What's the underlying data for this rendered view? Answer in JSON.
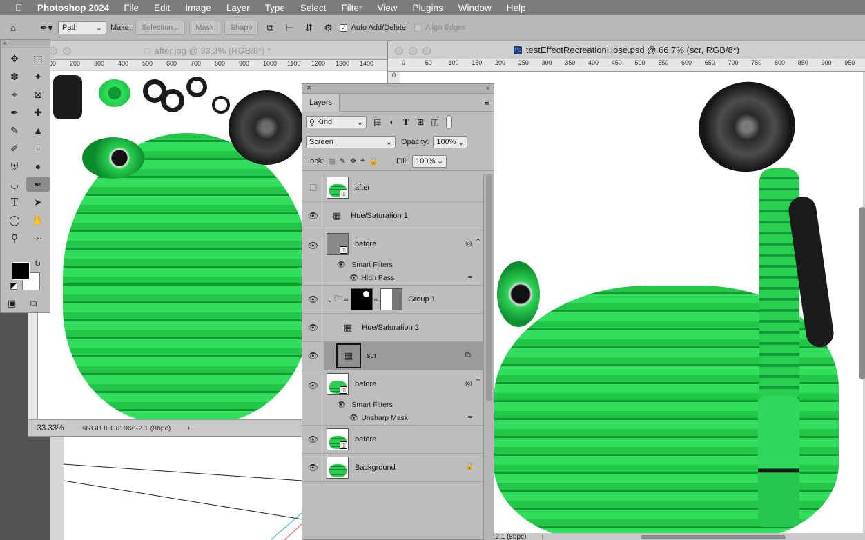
{
  "menubar": {
    "app_name": "Photoshop 2024",
    "items": [
      "File",
      "Edit",
      "Image",
      "Layer",
      "Type",
      "Select",
      "Filter",
      "View",
      "Plugins",
      "Window",
      "Help"
    ]
  },
  "options_bar": {
    "mode_select": "Path",
    "make_label": "Make:",
    "selection_button": "Selection...",
    "mask_button": "Mask",
    "shape_button": "Shape",
    "auto_add_delete_label": "Auto Add/Delete",
    "auto_add_delete_checked": true,
    "align_edges_label": "Align Edges"
  },
  "doc1": {
    "title": "after.jpg @ 33,3% (RGB/8*) *",
    "ruler_ticks": [
      "100",
      "200",
      "300",
      "400",
      "500",
      "600",
      "700",
      "800",
      "900",
      "1000",
      "1100",
      "1200",
      "1300",
      "1400"
    ],
    "zoom": "33.33%",
    "profile": "sRGB IEC61966-2.1 (8bpc)",
    "profile_arrow": "›"
  },
  "doc2": {
    "title": "testEffectRecreationHose.psd @ 66,7% (scr, RGB/8*)",
    "ruler_ticks": [
      "0",
      "50",
      "100",
      "150",
      "200",
      "250",
      "300",
      "350",
      "400",
      "450",
      "500",
      "550",
      "600",
      "650",
      "700",
      "750",
      "800",
      "850",
      "900",
      "950"
    ],
    "v_ruler": "0",
    "status": "-2.1 (8bpc)",
    "status_arrow": "›"
  },
  "layers_panel": {
    "tab": "Layers",
    "filter_kind": "Kind",
    "blend_mode": "Screen",
    "opacity_label": "Opacity:",
    "opacity_value": "100%",
    "lock_label": "Lock:",
    "fill_label": "Fill:",
    "fill_value": "100%",
    "layers": [
      {
        "name": "after",
        "visible": false
      },
      {
        "name": "Hue/Saturation 1",
        "visible": true
      },
      {
        "name": "before",
        "visible": true,
        "smart_filters_label": "Smart Filters",
        "filter": "High Pass"
      },
      {
        "name": "Group 1",
        "visible": true
      },
      {
        "name": "Hue/Saturation 2",
        "visible": true
      },
      {
        "name": "scr",
        "visible": true,
        "selected": true
      },
      {
        "name": "before",
        "visible": true,
        "smart_filters_label": "Smart Filters",
        "filter": "Unsharp Mask"
      },
      {
        "name": "before",
        "visible": true
      },
      {
        "name": "Background",
        "visible": true,
        "locked": true
      }
    ]
  },
  "colors": {
    "menubar": "#7c7c7c",
    "panel": "#bdbdbd",
    "hose_green": "#22c74a",
    "selected_layer": "#9b9b9b"
  }
}
